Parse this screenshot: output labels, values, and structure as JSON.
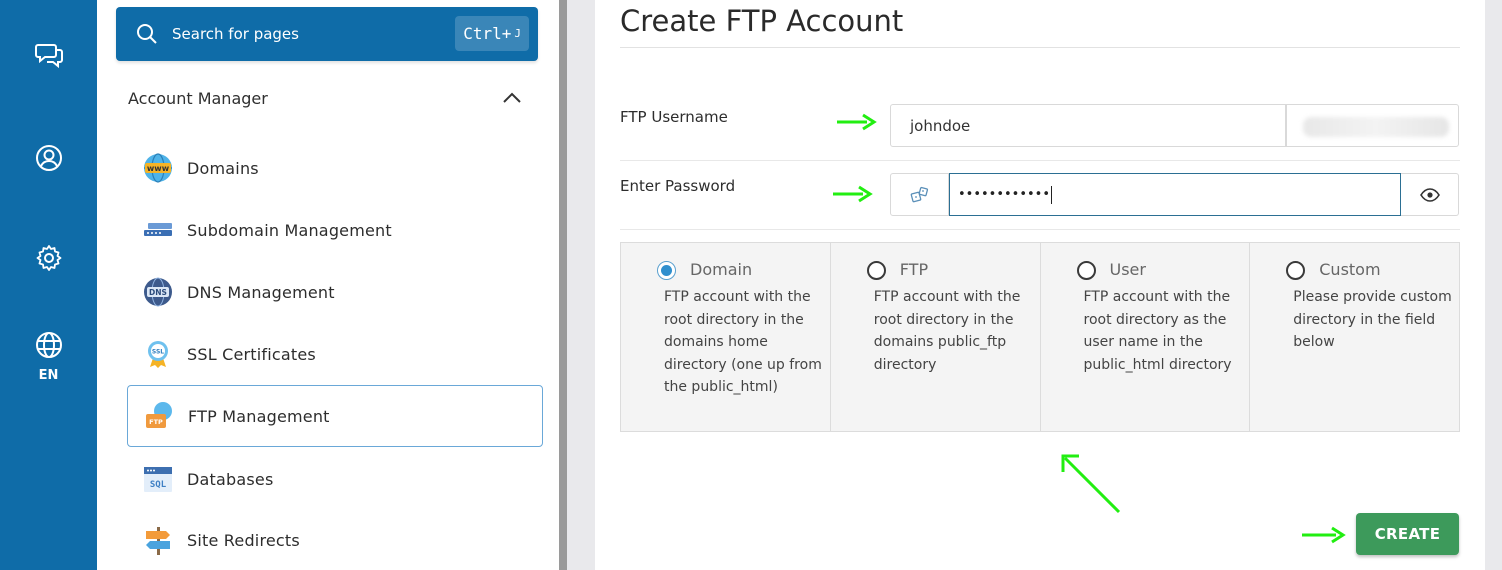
{
  "rail": {
    "items": [
      {
        "icon": "chat-icon"
      },
      {
        "icon": "user-icon"
      },
      {
        "icon": "gear-icon"
      },
      {
        "icon": "globe-icon",
        "label": "EN"
      }
    ]
  },
  "sidebar": {
    "search": {
      "label": "Search for pages",
      "shortcut_main": "Ctrl+",
      "shortcut_key": "J"
    },
    "section_title": "Account Manager",
    "items": [
      {
        "label": "Domains",
        "icon": "www-globe-icon"
      },
      {
        "label": "Subdomain Management",
        "icon": "subdomain-icon"
      },
      {
        "label": "DNS Management",
        "icon": "dns-icon"
      },
      {
        "label": "SSL Certificates",
        "icon": "ssl-badge-icon"
      },
      {
        "label": "FTP Management",
        "icon": "ftp-folder-icon",
        "active": true
      },
      {
        "label": "Databases",
        "icon": "sql-database-icon"
      },
      {
        "label": "Site Redirects",
        "icon": "signpost-icon"
      }
    ]
  },
  "main": {
    "title": "Create FTP Account",
    "username": {
      "label": "FTP Username",
      "value": "johndoe"
    },
    "password": {
      "label": "Enter Password",
      "value": "••••••••••••"
    },
    "options": [
      {
        "title": "Domain",
        "desc": "FTP account with the root directory in the domains home directory (one up from the public_html)",
        "checked": true
      },
      {
        "title": "FTP",
        "desc": "FTP account with the root directory in the domains public_ftp directory",
        "checked": false
      },
      {
        "title": "User",
        "desc": "FTP account with the root directory as the user name in the public_html directory",
        "checked": false
      },
      {
        "title": "Custom",
        "desc": "Please provide custom directory in the field below",
        "checked": false
      }
    ],
    "create_label": "CREATE"
  },
  "colors": {
    "rail": "#0f6ca8",
    "accent_radio": "#2f8fce",
    "create_button": "#3d9a5b",
    "annotation_arrow": "#22ee11"
  }
}
